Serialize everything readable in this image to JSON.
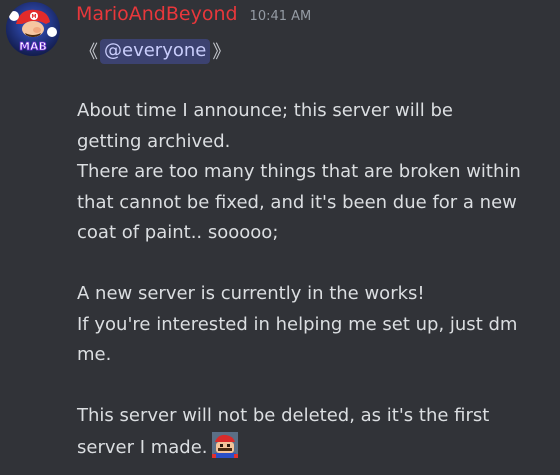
{
  "message": {
    "author": {
      "username": "MarioAndBeyond",
      "avatar_label": "MAB",
      "name_color": "#e8373b"
    },
    "timestamp": "10:41 AM",
    "mention": {
      "open_bracket": "《",
      "label": "@everyone",
      "close_bracket": "》"
    },
    "lines": {
      "l1": "About time I announce; this server will be",
      "l2": "getting archived.",
      "l3": "There are too many things that are broken within",
      "l4": "that cannot be fixed, and it's been due for a new",
      "l5": "coat of paint.. sooooo;",
      "l6": "A new server is currently in the works!",
      "l7": "If you're interested in helping me set up, just dm",
      "l8": "me.",
      "l9": "This server will not be deleted, as it's the first",
      "l10": "server I made."
    },
    "emoji": "mario-face-emoji"
  },
  "colors": {
    "background": "#313338",
    "text": "#dbdee1",
    "timestamp": "#949ba4",
    "mention_bg": "#3c4270",
    "mention_text": "#c9cdfb"
  }
}
